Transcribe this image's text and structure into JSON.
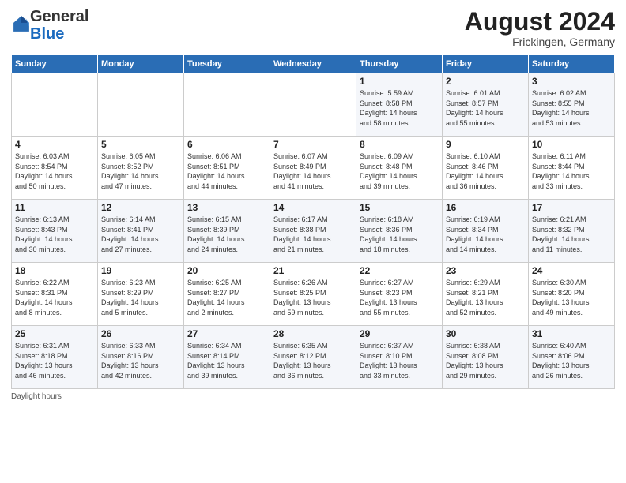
{
  "header": {
    "logo_general": "General",
    "logo_blue": "Blue",
    "month_title": "August 2024",
    "subtitle": "Frickingen, Germany"
  },
  "weekdays": [
    "Sunday",
    "Monday",
    "Tuesday",
    "Wednesday",
    "Thursday",
    "Friday",
    "Saturday"
  ],
  "weeks": [
    [
      {
        "day": "",
        "info": ""
      },
      {
        "day": "",
        "info": ""
      },
      {
        "day": "",
        "info": ""
      },
      {
        "day": "",
        "info": ""
      },
      {
        "day": "1",
        "info": "Sunrise: 5:59 AM\nSunset: 8:58 PM\nDaylight: 14 hours\nand 58 minutes."
      },
      {
        "day": "2",
        "info": "Sunrise: 6:01 AM\nSunset: 8:57 PM\nDaylight: 14 hours\nand 55 minutes."
      },
      {
        "day": "3",
        "info": "Sunrise: 6:02 AM\nSunset: 8:55 PM\nDaylight: 14 hours\nand 53 minutes."
      }
    ],
    [
      {
        "day": "4",
        "info": "Sunrise: 6:03 AM\nSunset: 8:54 PM\nDaylight: 14 hours\nand 50 minutes."
      },
      {
        "day": "5",
        "info": "Sunrise: 6:05 AM\nSunset: 8:52 PM\nDaylight: 14 hours\nand 47 minutes."
      },
      {
        "day": "6",
        "info": "Sunrise: 6:06 AM\nSunset: 8:51 PM\nDaylight: 14 hours\nand 44 minutes."
      },
      {
        "day": "7",
        "info": "Sunrise: 6:07 AM\nSunset: 8:49 PM\nDaylight: 14 hours\nand 41 minutes."
      },
      {
        "day": "8",
        "info": "Sunrise: 6:09 AM\nSunset: 8:48 PM\nDaylight: 14 hours\nand 39 minutes."
      },
      {
        "day": "9",
        "info": "Sunrise: 6:10 AM\nSunset: 8:46 PM\nDaylight: 14 hours\nand 36 minutes."
      },
      {
        "day": "10",
        "info": "Sunrise: 6:11 AM\nSunset: 8:44 PM\nDaylight: 14 hours\nand 33 minutes."
      }
    ],
    [
      {
        "day": "11",
        "info": "Sunrise: 6:13 AM\nSunset: 8:43 PM\nDaylight: 14 hours\nand 30 minutes."
      },
      {
        "day": "12",
        "info": "Sunrise: 6:14 AM\nSunset: 8:41 PM\nDaylight: 14 hours\nand 27 minutes."
      },
      {
        "day": "13",
        "info": "Sunrise: 6:15 AM\nSunset: 8:39 PM\nDaylight: 14 hours\nand 24 minutes."
      },
      {
        "day": "14",
        "info": "Sunrise: 6:17 AM\nSunset: 8:38 PM\nDaylight: 14 hours\nand 21 minutes."
      },
      {
        "day": "15",
        "info": "Sunrise: 6:18 AM\nSunset: 8:36 PM\nDaylight: 14 hours\nand 18 minutes."
      },
      {
        "day": "16",
        "info": "Sunrise: 6:19 AM\nSunset: 8:34 PM\nDaylight: 14 hours\nand 14 minutes."
      },
      {
        "day": "17",
        "info": "Sunrise: 6:21 AM\nSunset: 8:32 PM\nDaylight: 14 hours\nand 11 minutes."
      }
    ],
    [
      {
        "day": "18",
        "info": "Sunrise: 6:22 AM\nSunset: 8:31 PM\nDaylight: 14 hours\nand 8 minutes."
      },
      {
        "day": "19",
        "info": "Sunrise: 6:23 AM\nSunset: 8:29 PM\nDaylight: 14 hours\nand 5 minutes."
      },
      {
        "day": "20",
        "info": "Sunrise: 6:25 AM\nSunset: 8:27 PM\nDaylight: 14 hours\nand 2 minutes."
      },
      {
        "day": "21",
        "info": "Sunrise: 6:26 AM\nSunset: 8:25 PM\nDaylight: 13 hours\nand 59 minutes."
      },
      {
        "day": "22",
        "info": "Sunrise: 6:27 AM\nSunset: 8:23 PM\nDaylight: 13 hours\nand 55 minutes."
      },
      {
        "day": "23",
        "info": "Sunrise: 6:29 AM\nSunset: 8:21 PM\nDaylight: 13 hours\nand 52 minutes."
      },
      {
        "day": "24",
        "info": "Sunrise: 6:30 AM\nSunset: 8:20 PM\nDaylight: 13 hours\nand 49 minutes."
      }
    ],
    [
      {
        "day": "25",
        "info": "Sunrise: 6:31 AM\nSunset: 8:18 PM\nDaylight: 13 hours\nand 46 minutes."
      },
      {
        "day": "26",
        "info": "Sunrise: 6:33 AM\nSunset: 8:16 PM\nDaylight: 13 hours\nand 42 minutes."
      },
      {
        "day": "27",
        "info": "Sunrise: 6:34 AM\nSunset: 8:14 PM\nDaylight: 13 hours\nand 39 minutes."
      },
      {
        "day": "28",
        "info": "Sunrise: 6:35 AM\nSunset: 8:12 PM\nDaylight: 13 hours\nand 36 minutes."
      },
      {
        "day": "29",
        "info": "Sunrise: 6:37 AM\nSunset: 8:10 PM\nDaylight: 13 hours\nand 33 minutes."
      },
      {
        "day": "30",
        "info": "Sunrise: 6:38 AM\nSunset: 8:08 PM\nDaylight: 13 hours\nand 29 minutes."
      },
      {
        "day": "31",
        "info": "Sunrise: 6:40 AM\nSunset: 8:06 PM\nDaylight: 13 hours\nand 26 minutes."
      }
    ]
  ],
  "legend": {
    "daylight_label": "Daylight hours"
  }
}
